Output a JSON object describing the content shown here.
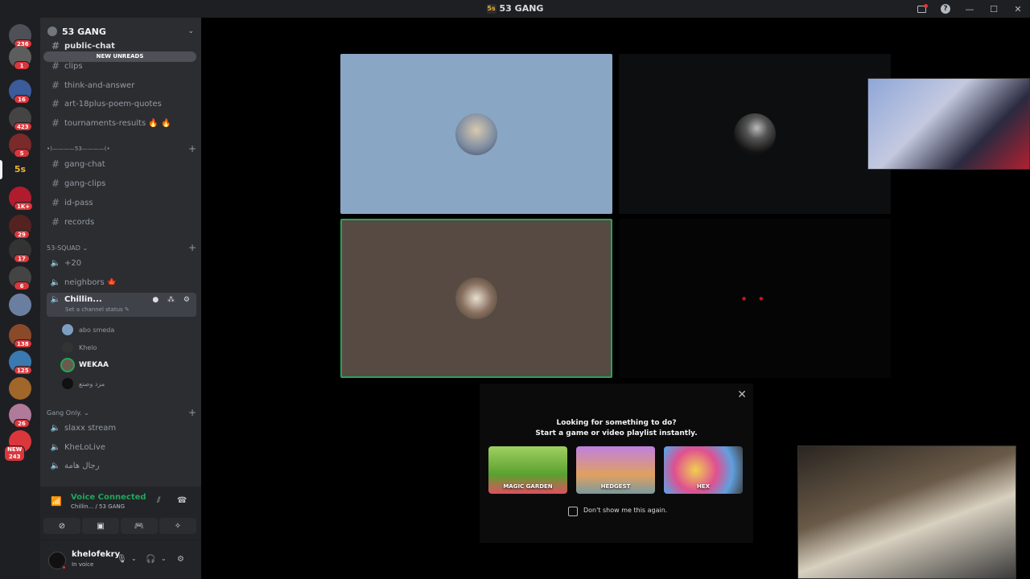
{
  "window": {
    "title": "53 GANG",
    "logo_text": "5s"
  },
  "titlebar_buttons": {
    "inbox_icon": "inbox-icon",
    "help": "?",
    "minimize": "—",
    "maximize": "☐",
    "close": "✕"
  },
  "guilds": [
    {
      "name": "home",
      "badge": "236",
      "color": "#4e5058"
    },
    {
      "name": "server-1",
      "badge": "1",
      "color": "#5d5d5d"
    },
    {
      "name": "server-2",
      "badge": "16",
      "color": "#3b5b9a"
    },
    {
      "name": "server-3",
      "badge": "423",
      "color": "#444"
    },
    {
      "name": "server-4",
      "badge": "5",
      "color": "#7a2a2a"
    },
    {
      "name": "53-gang",
      "badge": "",
      "color": "#1e1f22",
      "active": true
    },
    {
      "name": "server-6",
      "badge": "1K+",
      "color": "#b01c2e"
    },
    {
      "name": "server-7",
      "badge": "29",
      "color": "#522"
    },
    {
      "name": "server-8",
      "badge": "17",
      "color": "#333"
    },
    {
      "name": "server-9",
      "badge": "6",
      "color": "#444"
    },
    {
      "name": "server-10",
      "badge": "",
      "color": "#6a7fa0"
    },
    {
      "name": "server-11",
      "badge": "138",
      "color": "#8a4a2a"
    },
    {
      "name": "server-12",
      "badge": "125",
      "color": "#3a7ab0"
    },
    {
      "name": "server-13",
      "badge": "",
      "color": "#a0662a"
    },
    {
      "name": "server-14",
      "badge": "26",
      "color": "#b07a9a"
    },
    {
      "name": "server-15",
      "badge": "NEW 243",
      "color": "#da373c"
    }
  ],
  "server": {
    "name": "53 GANG",
    "new_unreads": "NEW UNREADS"
  },
  "channels": {
    "public_chat": "public-chat",
    "clips": "clips",
    "think": "think-and-answer",
    "art": "art-18plus-poem-quotes",
    "tournaments": "tournaments-results 🔥 🔥",
    "divider": "•)————53————(•",
    "gang_chat": "gang-chat",
    "gang_clips": "gang-clips",
    "id_pass": "id-pass",
    "records": "records"
  },
  "categories": {
    "squad": "53-SQUAD",
    "gang_only": "Gang Only."
  },
  "voice_channels": {
    "plus20": "+20",
    "neighbors": "neighbors 🍁",
    "chilling": "Chillin...",
    "chilling_status": "Set a channel status ✎",
    "slaxx": "slaxx stream",
    "khelo_live": "KheLoLive",
    "rigal": "رجال هامة"
  },
  "voice_users": [
    {
      "name": "abo smeda",
      "bold": false
    },
    {
      "name": "Khelo",
      "bold": false
    },
    {
      "name": "WEKAA",
      "bold": true
    },
    {
      "name": "مزد وصنع",
      "bold": false
    }
  ],
  "voice_panel": {
    "status": "Voice Connected",
    "channel": "Chillin... / 53 GANG"
  },
  "user_panel": {
    "name": "khelofekry",
    "status": "In voice"
  },
  "activity": {
    "line1": "Looking for something to do?",
    "line2": "Start a game or video playlist instantly.",
    "games": [
      "MAGIC GARDEN",
      "HEDGEST",
      "HEX"
    ],
    "dont_show": "Don't show me this again."
  },
  "colors": {
    "accent_green": "#23a55a",
    "tile_blue": "#89a7c4",
    "tile_brown": "#574a43",
    "badge_red": "#da373c"
  }
}
